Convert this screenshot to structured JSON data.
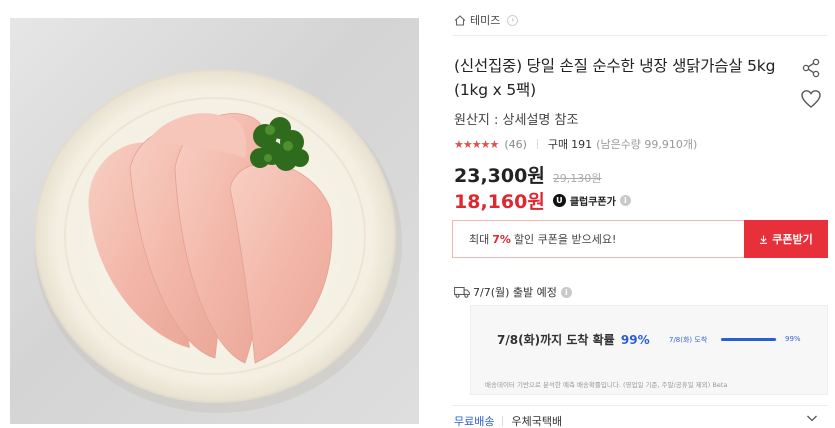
{
  "product_image": {
    "alt": "닭가슴살"
  },
  "seller": {
    "name": "테미즈",
    "icon": "home-icon"
  },
  "product": {
    "title": "(신선집중) 당일 손질 순수한 냉장 생닭가슴살 5kg (1kg x 5팩)",
    "origin": "원산지 : 상세설명 참조"
  },
  "rating": {
    "stars": "★★★★★",
    "review_count": "(46)",
    "buy_label": "구매",
    "buy_count": "191",
    "remaining": "(남은수량 99,910개)"
  },
  "price": {
    "sale": "23,300원",
    "original": "29,130원",
    "coupon_price": "18,160원",
    "club_badge": "U",
    "club_label": "클럽쿠폰가"
  },
  "coupon": {
    "pre": "최대",
    "percent": "7%",
    "post": "할인 쿠폰을 받으세요!",
    "button_label": "쿠폰받기"
  },
  "shipping": {
    "departure": "7/7(월) 출발 예정",
    "arrival_text": "7/8(화)까지 도착 확률",
    "arrival_percent": "99%",
    "bar_label": "7/8(화) 도착",
    "bar_percent_text": "99%",
    "bar_fill": 0.99,
    "note": "배송데이터 기반으로 분석한 예측 배송확률입니다. (영업일 기준, 주말/공휴일 제외) Beta",
    "free_label": "무료배송",
    "carrier": "우체국택배"
  },
  "colors": {
    "accent_red": "#e0262e",
    "accent_blue": "#2a5fd2"
  }
}
